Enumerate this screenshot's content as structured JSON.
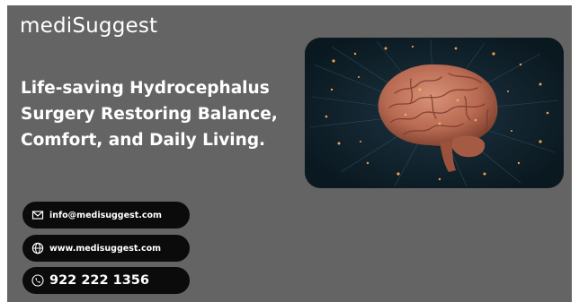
{
  "brand": {
    "name": "mediSuggest"
  },
  "headline": {
    "line1": "Life-saving Hydrocephalus",
    "line2": "Surgery Restoring Balance,",
    "line3": "Comfort, and Daily Living."
  },
  "contacts": {
    "email": "info@medisuggest.com",
    "website": "www.medisuggest.com",
    "phone": "922 222 1356"
  },
  "colors": {
    "background": "#646464",
    "pill": "#0b0b0b",
    "text": "#ffffff",
    "hero_bg": "#0c1c24",
    "brain": "#c07a5e",
    "sparks": "#f0a050"
  },
  "icons": {
    "email": "envelope-icon",
    "website": "globe-icon",
    "phone": "phone-icon"
  },
  "hero_image": "glowing-brain-illustration"
}
